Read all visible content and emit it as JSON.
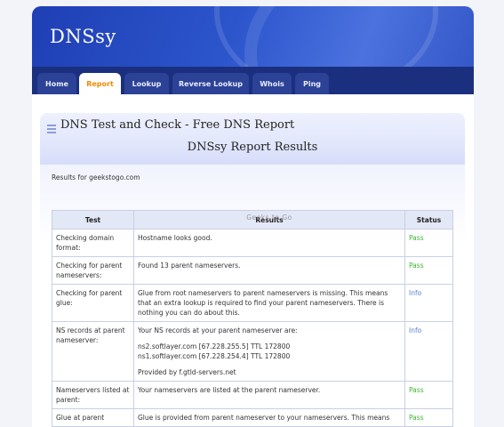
{
  "site": {
    "logo": "DNSsy"
  },
  "nav": {
    "tabs": [
      {
        "label": "Home",
        "active": false
      },
      {
        "label": "Report",
        "active": true
      },
      {
        "label": "Lookup",
        "active": false
      },
      {
        "label": "Reverse Lookup",
        "active": false
      },
      {
        "label": "Whois",
        "active": false
      },
      {
        "label": "Ping",
        "active": false
      }
    ]
  },
  "page": {
    "title": "DNS Test and Check - Free DNS Report",
    "heading": "DNSsy Report Results",
    "results_for": "Results for geekstogo.com",
    "watermark": "Geeks to Go"
  },
  "table": {
    "headers": [
      "Test",
      "Results",
      "Status"
    ],
    "rows": [
      {
        "test": "Checking domain format:",
        "result": [
          "Hostname looks good."
        ],
        "status": "Pass"
      },
      {
        "test": "Checking for parent nameservers:",
        "result": [
          "Found 13 parent nameservers."
        ],
        "status": "Pass"
      },
      {
        "test": "Checking for parent glue:",
        "result": [
          "Glue from root nameservers to parent nameservers is missing. This means that an extra lookup is required to find your parent nameservers. There is nothing you can do about this."
        ],
        "status": "Info"
      },
      {
        "test": "NS records at parent nameserver:",
        "result": [
          "Your NS records at your parent nameserver are:",
          "ns2.softlayer.com [67.228.255.5] TTL 172800",
          "ns1.softlayer.com [67.228.254.4] TTL 172800",
          "Provided by f.gtld-servers.net"
        ],
        "status": "Info"
      },
      {
        "test": "Nameservers listed at parent:",
        "result": [
          "Your nameservers are listed at the parent nameserver."
        ],
        "status": "Pass"
      },
      {
        "test": "Glue at parent",
        "result": [
          "Glue is provided from parent nameserver to your nameservers. This means"
        ],
        "status": "Pass"
      }
    ]
  },
  "colors": {
    "pass": "#3cb332",
    "info": "#5a7fd0",
    "active_tab": "#f08a00",
    "nav_bg": "#1a2f7e"
  }
}
